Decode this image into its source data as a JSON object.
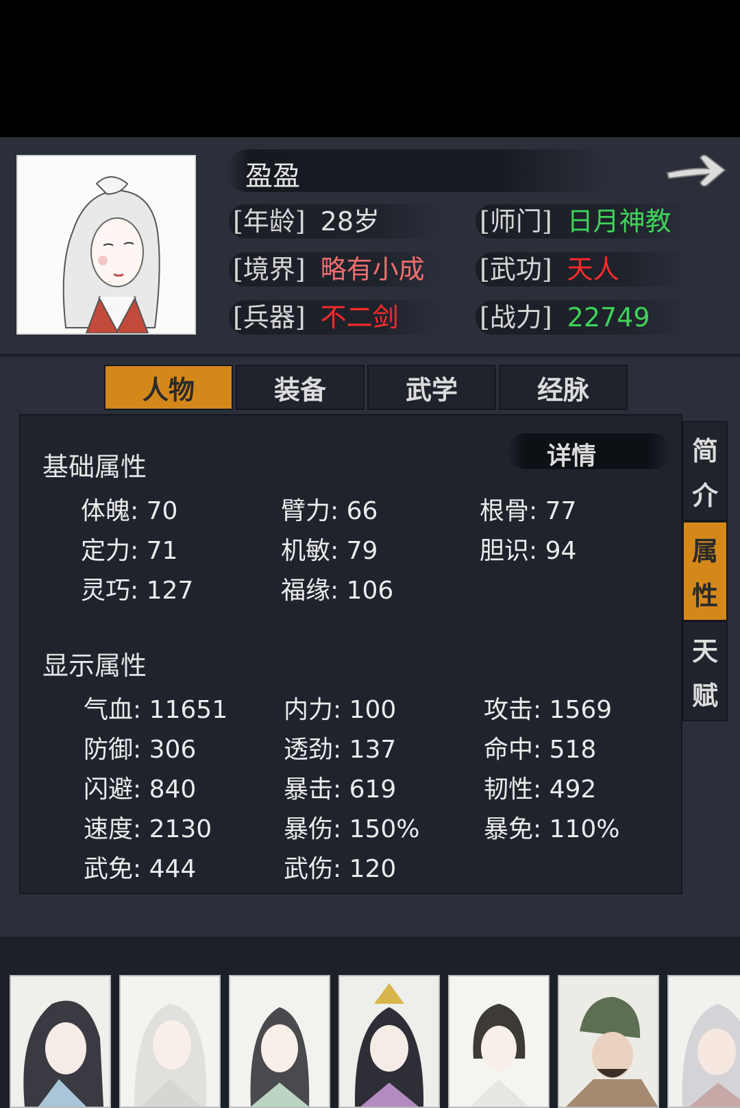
{
  "character": {
    "name": "盈盈",
    "fields": [
      {
        "label": "[年龄]",
        "value": "28岁",
        "color": "#e0e0e0"
      },
      {
        "label": "[师门]",
        "value": "日月神教",
        "color": "#3fd35a"
      },
      {
        "label": "[境界]",
        "value": "略有小成",
        "color": "#f06e6e"
      },
      {
        "label": "[武功]",
        "value": "天人",
        "color": "#ff2a2a"
      },
      {
        "label": "[兵器]",
        "value": "不二剑",
        "color": "#ff2a2a"
      },
      {
        "label": "[战力]",
        "value": "22749",
        "color": "#3fd35a"
      }
    ]
  },
  "tabs": [
    "人物",
    "装备",
    "武学",
    "经脉"
  ],
  "active_tab": "人物",
  "side_tabs": [
    [
      "简",
      "介"
    ],
    [
      "属",
      "性"
    ],
    [
      "天",
      "赋"
    ]
  ],
  "active_side_tab": "属性",
  "detail_label": "详情",
  "basic": {
    "title": "基础属性",
    "stats": [
      "体魄: 70",
      "臂力: 66",
      "根骨: 77",
      "定力: 71",
      "机敏: 79",
      "胆识: 94",
      "灵巧: 127",
      "福缘: 106"
    ]
  },
  "display": {
    "title": "显示属性",
    "stats": [
      "气血: 11651",
      "内力: 100",
      "攻击: 1569",
      "防御: 306",
      "透劲: 137",
      "命中: 518",
      "闪避: 840",
      "暴击: 619",
      "韧性: 492",
      "速度: 2130",
      "暴伤: 150%",
      "暴免: 110%",
      "武免: 444",
      "武伤: 120"
    ]
  },
  "colors": {
    "accent": "#d5881a",
    "panel": "#2a2f3a",
    "box": "#1f232c"
  },
  "icons": {
    "next": "right-arrow-icon"
  }
}
